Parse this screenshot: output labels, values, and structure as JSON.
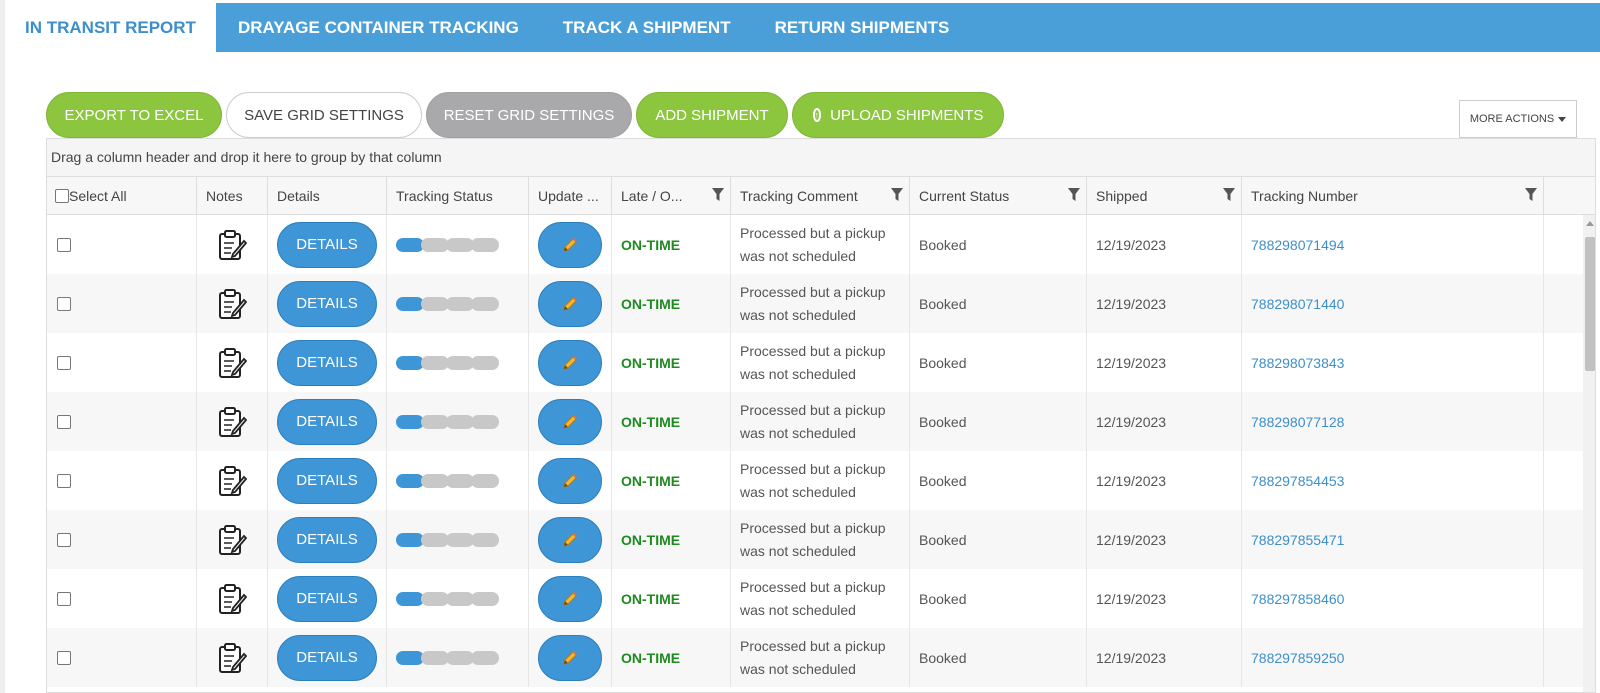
{
  "tabs": [
    {
      "label": "IN TRANSIT REPORT",
      "active": true
    },
    {
      "label": "DRAYAGE CONTAINER TRACKING",
      "active": false
    },
    {
      "label": "TRACK A SHIPMENT",
      "active": false
    },
    {
      "label": "RETURN SHIPMENTS",
      "active": false
    }
  ],
  "toolbar": {
    "export_label": "EXPORT TO EXCEL",
    "save_grid_label": "SAVE GRID SETTINGS",
    "reset_grid_label": "RESET GRID SETTINGS",
    "add_shipment_label": "ADD SHIPMENT",
    "upload_label": "UPLOAD SHIPMENTS",
    "more_actions_label": "MORE ACTIONS"
  },
  "grid": {
    "group_hint": "Drag a column header and drop it here to group by that column",
    "columns": {
      "select_all": "Select All",
      "notes": "Notes",
      "details": "Details",
      "tracking_status": "Tracking Status",
      "update": "Update ...",
      "late": "Late / O...",
      "tracking_comment": "Tracking Comment",
      "current_status": "Current Status",
      "shipped": "Shipped",
      "tracking_number": "Tracking Number"
    },
    "details_label": "DETAILS",
    "rows": [
      {
        "late": "ON-TIME",
        "comment": "Processed but a pickup was not scheduled",
        "status": "Booked",
        "shipped": "12/19/2023",
        "tracking": "788298071494",
        "progress_steps_done": 1,
        "progress_steps_total": 4
      },
      {
        "late": "ON-TIME",
        "comment": "Processed but a pickup was not scheduled",
        "status": "Booked",
        "shipped": "12/19/2023",
        "tracking": "788298071440",
        "progress_steps_done": 1,
        "progress_steps_total": 4
      },
      {
        "late": "ON-TIME",
        "comment": "Processed but a pickup was not scheduled",
        "status": "Booked",
        "shipped": "12/19/2023",
        "tracking": "788298073843",
        "progress_steps_done": 1,
        "progress_steps_total": 4
      },
      {
        "late": "ON-TIME",
        "comment": "Processed but a pickup was not scheduled",
        "status": "Booked",
        "shipped": "12/19/2023",
        "tracking": "788298077128",
        "progress_steps_done": 1,
        "progress_steps_total": 4
      },
      {
        "late": "ON-TIME",
        "comment": "Processed but a pickup was not scheduled",
        "status": "Booked",
        "shipped": "12/19/2023",
        "tracking": "788297854453",
        "progress_steps_done": 1,
        "progress_steps_total": 4
      },
      {
        "late": "ON-TIME",
        "comment": "Processed but a pickup was not scheduled",
        "status": "Booked",
        "shipped": "12/19/2023",
        "tracking": "788297855471",
        "progress_steps_done": 1,
        "progress_steps_total": 4
      },
      {
        "late": "ON-TIME",
        "comment": "Processed but a pickup was not scheduled",
        "status": "Booked",
        "shipped": "12/19/2023",
        "tracking": "788297858460",
        "progress_steps_done": 1,
        "progress_steps_total": 4
      },
      {
        "late": "ON-TIME",
        "comment": "Processed but a pickup was not scheduled",
        "status": "Booked",
        "shipped": "12/19/2023",
        "tracking": "788297859250",
        "progress_steps_done": 1,
        "progress_steps_total": 4
      }
    ]
  },
  "colors": {
    "tab_bar": "#4a9fd8",
    "green": "#8cc63f",
    "blue_button": "#3f96d6",
    "on_time": "#1f8a1f",
    "link": "#3d8fcb"
  },
  "icons": {
    "notes": "clipboard-icon",
    "update": "pencil-icon",
    "filter": "filter-icon",
    "upload": "upload-icon"
  }
}
